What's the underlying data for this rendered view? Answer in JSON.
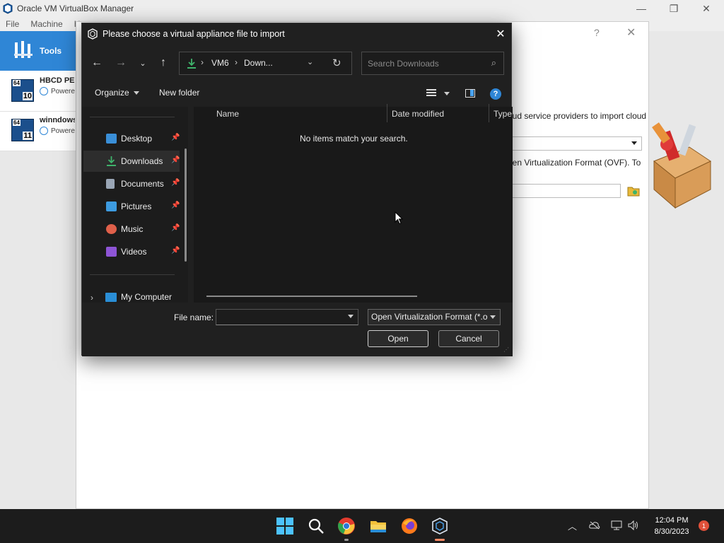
{
  "app": {
    "title": "Oracle VM VirtualBox Manager",
    "menu": [
      "File",
      "Machine",
      "H"
    ]
  },
  "sidebar": {
    "tools_label": "Tools",
    "vms": [
      {
        "name": "HBCD PE x",
        "state": "Powered Off",
        "os_bits": "64",
        "os_version": "10"
      },
      {
        "name": "winndows",
        "state": "Powered Off",
        "os_bits": "64",
        "os_version": "11"
      }
    ]
  },
  "wizard": {
    "help": "?",
    "close": "✕",
    "text1": "oud service providers to import cloud",
    "text2": "pen Virtualization Format (OVF). To"
  },
  "dialog": {
    "title": "Please choose a virtual appliance file to import",
    "breadcrumb": [
      "VM6",
      "Down..."
    ],
    "search_placeholder": "Search Downloads",
    "organize": "Organize",
    "new_folder": "New folder",
    "columns": [
      "Name",
      "Date modified",
      "Type"
    ],
    "empty_message": "No items match your search.",
    "nav": [
      {
        "label": "Desktop",
        "icon": "desktop-icon",
        "color": "#3a8fd8"
      },
      {
        "label": "Downloads",
        "icon": "downloads-icon",
        "color": "#3fb36b",
        "selected": true
      },
      {
        "label": "Documents",
        "icon": "documents-icon",
        "color": "#9aa6b6"
      },
      {
        "label": "Pictures",
        "icon": "pictures-icon",
        "color": "#3d9be0"
      },
      {
        "label": "Music",
        "icon": "music-icon",
        "color": "#e0604a"
      },
      {
        "label": "Videos",
        "icon": "videos-icon",
        "color": "#8e55d6"
      }
    ],
    "my_computer": "My Computer",
    "file_name_label": "File name:",
    "file_name_value": "",
    "filter": "Open Virtualization Format (*.o",
    "open_button": "Open",
    "cancel_button": "Cancel"
  },
  "taskbar": {
    "time": "12:04 PM",
    "date": "8/30/2023",
    "notification_count": "1"
  }
}
